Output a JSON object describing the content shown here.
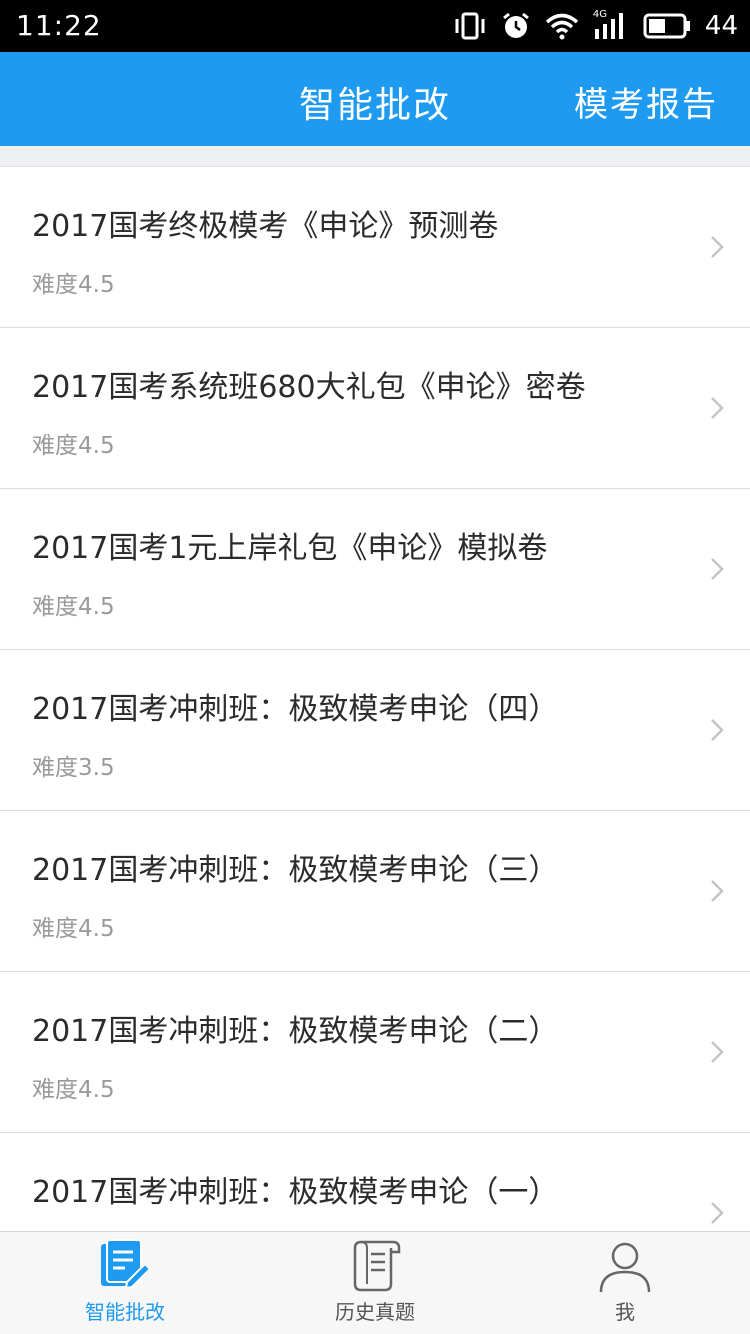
{
  "status_bar": {
    "time": "11:22",
    "network_label": "4G",
    "battery_level": "44",
    "icons": [
      "vibrate-icon",
      "alarm-icon",
      "wifi-icon",
      "signal-icon",
      "battery-icon"
    ]
  },
  "header": {
    "title": "智能批改",
    "action_label": "模考报告",
    "background_color": "#1e9bf0"
  },
  "papers": [
    {
      "title": "2017国考终极模考《申论》预测卷",
      "difficulty": "难度4.5"
    },
    {
      "title": "2017国考系统班680大礼包《申论》密卷",
      "difficulty": "难度4.5"
    },
    {
      "title": "2017国考1元上岸礼包《申论》模拟卷",
      "difficulty": "难度4.5"
    },
    {
      "title": "2017国考冲刺班：极致模考申论（四）",
      "difficulty": "难度3.5"
    },
    {
      "title": "2017国考冲刺班：极致模考申论（三）",
      "difficulty": "难度4.5"
    },
    {
      "title": "2017国考冲刺班：极致模考申论（二）",
      "difficulty": "难度4.5"
    },
    {
      "title": "2017国考冲刺班：极致模考申论（一）",
      "difficulty": ""
    }
  ],
  "tabs": [
    {
      "label": "智能批改",
      "icon": "edit-paper-icon",
      "active": true
    },
    {
      "label": "历史真题",
      "icon": "scroll-icon",
      "active": false
    },
    {
      "label": "我",
      "icon": "person-icon",
      "active": false
    }
  ],
  "colors": {
    "accent": "#1e9bf0",
    "tab_inactive": "#555555"
  }
}
